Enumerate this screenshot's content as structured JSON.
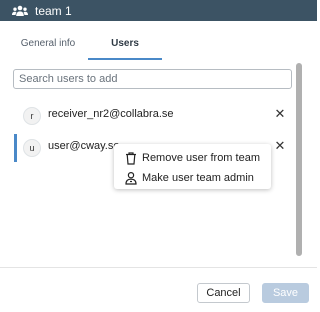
{
  "window": {
    "title": "team 1",
    "icon": "team-icon"
  },
  "tabs": [
    {
      "label": "General info",
      "active": false
    },
    {
      "label": "Users",
      "active": true
    }
  ],
  "search": {
    "placeholder": "Search users to add",
    "value": ""
  },
  "users": [
    {
      "initial": "r",
      "email": "receiver_nr2@collabra.se",
      "remove_icon": "close-icon",
      "selected": false
    },
    {
      "initial": "u",
      "email": "user@cway.se",
      "remove_icon": "close-icon",
      "selected": true
    }
  ],
  "context_menu": {
    "items": [
      {
        "label": "Remove user from team",
        "icon": "trash-icon"
      },
      {
        "label": "Make user team admin",
        "icon": "user-admin-icon"
      }
    ]
  },
  "footer": {
    "cancel_label": "Cancel",
    "save_label": "Save"
  },
  "colors": {
    "titlebar": "#3c5364",
    "accent": "#4a89c8",
    "save_disabled": "#b9cbdf"
  }
}
